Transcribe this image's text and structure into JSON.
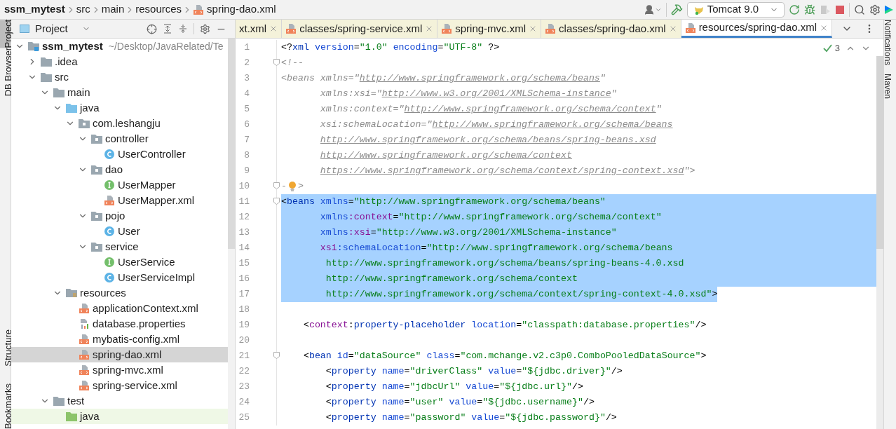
{
  "breadcrumb": [
    {
      "label": "ssm_mytest",
      "kind": "project"
    },
    {
      "label": "src",
      "kind": "folder"
    },
    {
      "label": "main",
      "kind": "folder"
    },
    {
      "label": "resources",
      "kind": "folder"
    },
    {
      "label": "spring-dao.xml",
      "kind": "xml"
    }
  ],
  "toolbar": {
    "run_config": "Tomcat 9.0"
  },
  "left_strip": [
    {
      "label": "Project",
      "selected": true
    },
    {
      "label": "DB Browser",
      "selected": false
    },
    {
      "label": "Structure",
      "selected": false
    },
    {
      "label": "Bookmarks",
      "selected": false
    }
  ],
  "right_strip": [
    {
      "label": "Notifications"
    },
    {
      "label": "Maven"
    }
  ],
  "project_panel": {
    "title": "Project",
    "tree": [
      {
        "label": "ssm_mytest",
        "path": "~/Desktop/JavaRelated/Te",
        "kind": "module",
        "expanded": true,
        "selected": false,
        "children": [
          {
            "label": ".idea",
            "kind": "folder",
            "expanded": false,
            "selected": false
          },
          {
            "label": "src",
            "kind": "folder",
            "expanded": true,
            "selected": false,
            "children": [
              {
                "label": "main",
                "kind": "folder",
                "expanded": true,
                "selected": false,
                "children": [
                  {
                    "label": "java",
                    "kind": "source_folder",
                    "expanded": true,
                    "selected": false,
                    "children": [
                      {
                        "label": "com.leshangju",
                        "kind": "package",
                        "expanded": true,
                        "selected": false,
                        "children": [
                          {
                            "label": "controller",
                            "kind": "package",
                            "expanded": true,
                            "selected": false,
                            "children": [
                              {
                                "label": "UserController",
                                "kind": "class",
                                "selected": false
                              }
                            ]
                          },
                          {
                            "label": "dao",
                            "kind": "package",
                            "expanded": true,
                            "selected": false,
                            "children": [
                              {
                                "label": "UserMapper",
                                "kind": "interface",
                                "selected": false
                              },
                              {
                                "label": "UserMapper.xml",
                                "kind": "xml",
                                "selected": false
                              }
                            ]
                          },
                          {
                            "label": "pojo",
                            "kind": "package",
                            "expanded": true,
                            "selected": false,
                            "children": [
                              {
                                "label": "User",
                                "kind": "class",
                                "selected": false
                              }
                            ]
                          },
                          {
                            "label": "service",
                            "kind": "package",
                            "expanded": true,
                            "selected": false,
                            "children": [
                              {
                                "label": "UserService",
                                "kind": "interface",
                                "selected": false
                              },
                              {
                                "label": "UserServiceImpl",
                                "kind": "class",
                                "selected": false
                              }
                            ]
                          }
                        ]
                      }
                    ]
                  },
                  {
                    "label": "resources",
                    "kind": "resources_folder",
                    "expanded": true,
                    "selected": false,
                    "children": [
                      {
                        "label": "applicationContext.xml",
                        "kind": "xml",
                        "selected": false
                      },
                      {
                        "label": "database.properties",
                        "kind": "properties",
                        "selected": false
                      },
                      {
                        "label": "mybatis-config.xml",
                        "kind": "xml",
                        "selected": false
                      },
                      {
                        "label": "spring-dao.xml",
                        "kind": "xml",
                        "selected": true
                      },
                      {
                        "label": "spring-mvc.xml",
                        "kind": "xml",
                        "selected": false
                      },
                      {
                        "label": "spring-service.xml",
                        "kind": "xml",
                        "selected": false
                      }
                    ]
                  }
                ]
              },
              {
                "label": "test",
                "kind": "folder",
                "expanded": true,
                "selected": false,
                "children": [
                  {
                    "label": "java",
                    "kind": "test_source_folder",
                    "selected": false
                  }
                ]
              }
            ]
          }
        ]
      }
    ]
  },
  "tabs": [
    {
      "label": "xt.xml",
      "selected": false
    },
    {
      "label": "classes/spring-service.xml",
      "selected": false
    },
    {
      "label": "spring-mvc.xml",
      "selected": false
    },
    {
      "label": "classes/spring-dao.xml",
      "selected": false
    },
    {
      "label": "resources/spring-dao.xml",
      "selected": true
    }
  ],
  "inspections": {
    "count": "3"
  },
  "lines": [
    {
      "number": "1",
      "selected": false,
      "fold": false,
      "tokens": [
        {
          "kind": "punct",
          "text": "<?"
        },
        {
          "kind": "tag",
          "text": "xml"
        },
        {
          "kind": "attr",
          "text": " version"
        },
        {
          "kind": "punct",
          "text": "="
        },
        {
          "kind": "value",
          "text": "\"1.0\""
        },
        {
          "kind": "attr",
          "text": " encoding"
        },
        {
          "kind": "punct",
          "text": "="
        },
        {
          "kind": "value",
          "text": "\"UTF-8\""
        },
        {
          "kind": "punct",
          "text": " ?>"
        }
      ]
    },
    {
      "number": "2",
      "selected": false,
      "fold": true,
      "tokens": [
        {
          "kind": "comment",
          "text": "<!--"
        }
      ]
    },
    {
      "number": "3",
      "selected": false,
      "fold": false,
      "tokens": [
        {
          "kind": "comment",
          "text": "<beans xmlns=\""
        },
        {
          "kind": "link",
          "text": "http://www.springframework.org/schema/beans"
        },
        {
          "kind": "comment",
          "text": "\""
        }
      ]
    },
    {
      "number": "4",
      "selected": false,
      "fold": false,
      "tokens": [
        {
          "kind": "comment",
          "text": "       xmlns:xsi=\""
        },
        {
          "kind": "link",
          "text": "http://www.w3.org/2001/XMLSchema-instance"
        },
        {
          "kind": "comment",
          "text": "\""
        }
      ]
    },
    {
      "number": "5",
      "selected": false,
      "fold": false,
      "tokens": [
        {
          "kind": "comment",
          "text": "       xmlns:context=\""
        },
        {
          "kind": "link",
          "text": "http://www.springframework.org/schema/context"
        },
        {
          "kind": "comment",
          "text": "\""
        }
      ]
    },
    {
      "number": "6",
      "selected": false,
      "fold": false,
      "tokens": [
        {
          "kind": "comment",
          "text": "       xsi:schemaLocation=\""
        },
        {
          "kind": "link",
          "text": "http://www.springframework.org/schema/beans"
        }
      ]
    },
    {
      "number": "7",
      "selected": false,
      "fold": false,
      "tokens": [
        {
          "kind": "link",
          "text": "       http://www.springframework.org/schema/beans/spring-beans.xsd"
        }
      ]
    },
    {
      "number": "8",
      "selected": false,
      "fold": false,
      "tokens": [
        {
          "kind": "link",
          "text": "       http://www.springframework.org/schema/context"
        }
      ]
    },
    {
      "number": "9",
      "selected": false,
      "fold": false,
      "tokens": [
        {
          "kind": "link",
          "text": "       https://www.springframework.org/schema/context/spring-context.xsd"
        },
        {
          "kind": "comment",
          "text": "\">"
        }
      ]
    },
    {
      "number": "10",
      "selected": false,
      "fold": true,
      "intention_bulb": true,
      "tokens": [
        {
          "kind": "comment",
          "text": "-"
        },
        {
          "kind": "comment",
          "text": ">"
        }
      ]
    },
    {
      "number": "11",
      "selected": true,
      "fold": true,
      "tokens": [
        {
          "kind": "punct",
          "text": "<"
        },
        {
          "kind": "tag",
          "text": "beans"
        },
        {
          "kind": "attr",
          "text": " xmlns"
        },
        {
          "kind": "punct",
          "text": "="
        },
        {
          "kind": "value",
          "text": "\"http://www.springframework.org/schema/beans\""
        }
      ]
    },
    {
      "number": "12",
      "selected": true,
      "fold": false,
      "tokens": [
        {
          "kind": "attr",
          "text": "       xmlns"
        },
        {
          "kind": "ns",
          "text": ":context"
        },
        {
          "kind": "punct",
          "text": "="
        },
        {
          "kind": "value",
          "text": "\"http://www.springframework.org/schema/context\""
        }
      ]
    },
    {
      "number": "13",
      "selected": true,
      "fold": false,
      "tokens": [
        {
          "kind": "attr",
          "text": "       xmlns"
        },
        {
          "kind": "ns",
          "text": ":xsi"
        },
        {
          "kind": "punct",
          "text": "="
        },
        {
          "kind": "value",
          "text": "\"http://www.w3.org/2001/XMLSchema-instance\""
        }
      ]
    },
    {
      "number": "14",
      "selected": true,
      "fold": false,
      "tokens": [
        {
          "kind": "ns",
          "text": "       xsi"
        },
        {
          "kind": "attr",
          "text": ":schemaLocation"
        },
        {
          "kind": "punct",
          "text": "="
        },
        {
          "kind": "value",
          "text": "\"http://www.springframework.org/schema/beans"
        }
      ]
    },
    {
      "number": "15",
      "selected": true,
      "fold": false,
      "tokens": [
        {
          "kind": "value",
          "text": "        http://www.springframework.org/schema/beans/spring-beans-4.0.xsd"
        }
      ]
    },
    {
      "number": "16",
      "selected": true,
      "fold": false,
      "tokens": [
        {
          "kind": "value",
          "text": "        http://www.springframework.org/schema/context"
        }
      ]
    },
    {
      "number": "17",
      "selected": true,
      "fold": false,
      "tokens": [
        {
          "kind": "value",
          "text": "        http://www.springframework.org/schema/context/spring-context-4.0.xsd\""
        },
        {
          "kind": "punct",
          "text": ">"
        }
      ]
    },
    {
      "number": "18",
      "selected": false,
      "fold": false
    },
    {
      "number": "19",
      "selected": false,
      "fold": false,
      "tokens": [
        {
          "kind": "punct",
          "text": "    <"
        },
        {
          "kind": "ns",
          "text": "context"
        },
        {
          "kind": "punct",
          "text": ":"
        },
        {
          "kind": "tag",
          "text": "property-placeholder"
        },
        {
          "kind": "attr",
          "text": " location"
        },
        {
          "kind": "punct",
          "text": "="
        },
        {
          "kind": "value",
          "text": "\"classpath:database.properties\""
        },
        {
          "kind": "punct",
          "text": "/>"
        }
      ]
    },
    {
      "number": "20",
      "selected": false,
      "fold": false
    },
    {
      "number": "21",
      "selected": false,
      "fold": true,
      "tokens": [
        {
          "kind": "punct",
          "text": "    <"
        },
        {
          "kind": "tag",
          "text": "bean"
        },
        {
          "kind": "attr",
          "text": " id"
        },
        {
          "kind": "punct",
          "text": "="
        },
        {
          "kind": "value",
          "text": "\"dataSource\""
        },
        {
          "kind": "attr",
          "text": " class"
        },
        {
          "kind": "punct",
          "text": "="
        },
        {
          "kind": "value",
          "text": "\"com.mchange.v2.c3p0.ComboPooledDataSource\""
        },
        {
          "kind": "punct",
          "text": ">"
        }
      ]
    },
    {
      "number": "22",
      "selected": false,
      "fold": false,
      "tokens": [
        {
          "kind": "punct",
          "text": "        <"
        },
        {
          "kind": "tag",
          "text": "property"
        },
        {
          "kind": "attr",
          "text": " name"
        },
        {
          "kind": "punct",
          "text": "="
        },
        {
          "kind": "value",
          "text": "\"driverClass\""
        },
        {
          "kind": "attr",
          "text": " value"
        },
        {
          "kind": "punct",
          "text": "="
        },
        {
          "kind": "value",
          "text": "\"${jdbc.driver}\""
        },
        {
          "kind": "punct",
          "text": "/>"
        }
      ]
    },
    {
      "number": "23",
      "selected": false,
      "fold": false,
      "tokens": [
        {
          "kind": "punct",
          "text": "        <"
        },
        {
          "kind": "tag",
          "text": "property"
        },
        {
          "kind": "attr",
          "text": " name"
        },
        {
          "kind": "punct",
          "text": "="
        },
        {
          "kind": "value",
          "text": "\"jdbcUrl\""
        },
        {
          "kind": "attr",
          "text": " value"
        },
        {
          "kind": "punct",
          "text": "="
        },
        {
          "kind": "value",
          "text": "\"${jdbc.url}\""
        },
        {
          "kind": "punct",
          "text": "/>"
        }
      ]
    },
    {
      "number": "24",
      "selected": false,
      "fold": false,
      "tokens": [
        {
          "kind": "punct",
          "text": "        <"
        },
        {
          "kind": "tag",
          "text": "property"
        },
        {
          "kind": "attr",
          "text": " name"
        },
        {
          "kind": "punct",
          "text": "="
        },
        {
          "kind": "value",
          "text": "\"user\""
        },
        {
          "kind": "attr",
          "text": " value"
        },
        {
          "kind": "punct",
          "text": "="
        },
        {
          "kind": "value",
          "text": "\"${jdbc.username}\""
        },
        {
          "kind": "punct",
          "text": "/>"
        }
      ]
    },
    {
      "number": "25",
      "selected": false,
      "fold": false,
      "tokens": [
        {
          "kind": "punct",
          "text": "        <"
        },
        {
          "kind": "tag",
          "text": "property"
        },
        {
          "kind": "attr",
          "text": " name"
        },
        {
          "kind": "punct",
          "text": "="
        },
        {
          "kind": "value",
          "text": "\"password\""
        },
        {
          "kind": "attr",
          "text": " value"
        },
        {
          "kind": "punct",
          "text": "="
        },
        {
          "kind": "value",
          "text": "\"${jdbc.password}\""
        },
        {
          "kind": "punct",
          "text": "/>"
        }
      ]
    }
  ]
}
